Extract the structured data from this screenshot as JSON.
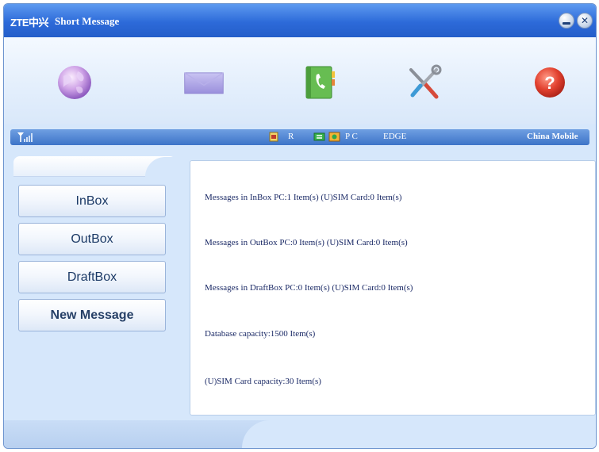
{
  "window": {
    "logo": "ZTE中兴",
    "title": "Short Message",
    "minimize_icon": "minimize-icon",
    "close_icon": "close-icon"
  },
  "toolbar": {
    "items": [
      {
        "icon": "internet-globe-icon",
        "color": "#b48ad8"
      },
      {
        "icon": "message-envelope-icon",
        "color": "#a89ee0"
      },
      {
        "icon": "phonebook-icon",
        "color": "#6cc25a"
      },
      {
        "icon": "settings-tools-icon",
        "color": "#d64a3a"
      },
      {
        "icon": "help-icon",
        "color": "#e03b2e"
      }
    ]
  },
  "status": {
    "roaming": "R",
    "pc_label": "P C",
    "network": "EDGE",
    "operator": "China Mobile"
  },
  "nav": {
    "inbox": "InBox",
    "outbox": "OutBox",
    "draftbox": "DraftBox",
    "new_message": "New Message"
  },
  "info": {
    "inbox_line": "Messages in InBox   PC:1 Item(s)  (U)SIM Card:0 Item(s)",
    "outbox_line": "Messages in OutBox   PC:0 Item(s)  (U)SIM Card:0 Item(s)",
    "draft_line": "Messages in DraftBox PC:0 Item(s)  (U)SIM Card:0 Item(s)",
    "db_capacity": "Database capacity:1500 Item(s)",
    "sim_capacity": "(U)SIM Card capacity:30 Item(s)"
  },
  "colors": {
    "title_bar": "#2d6ad9",
    "status_bar": "#4a80d0",
    "panel_bg": "#d6e7fb",
    "text": "#1b2a66"
  }
}
